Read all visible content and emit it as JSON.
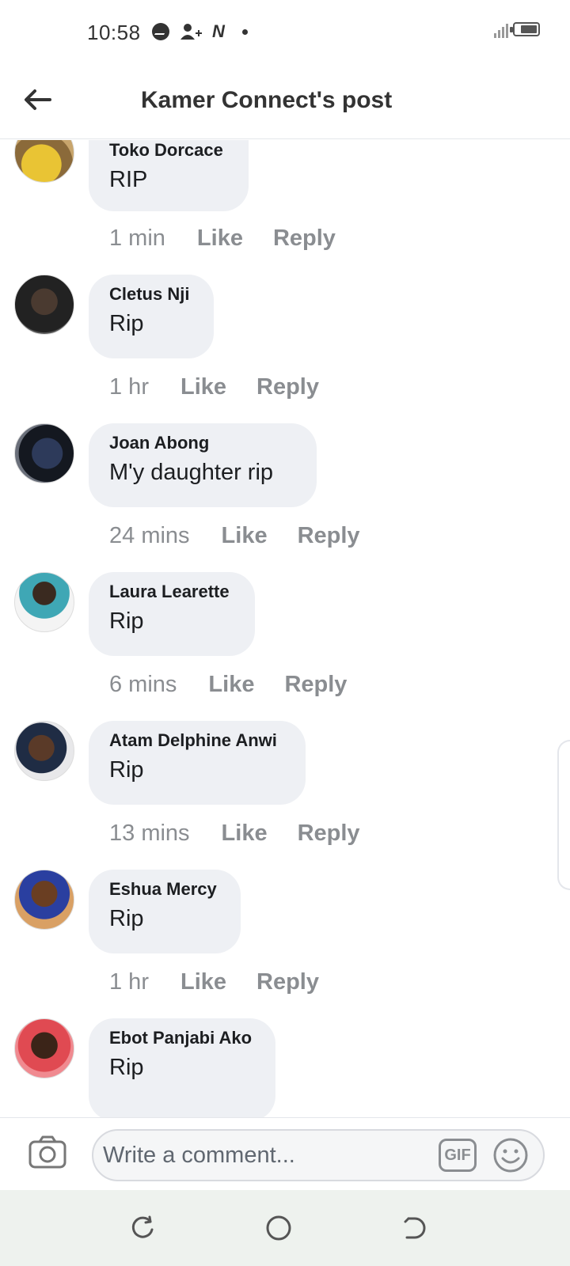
{
  "status_bar": {
    "time": "10:58",
    "notif_n": "N"
  },
  "header": {
    "title": "Kamer Connect's post"
  },
  "comments": [
    {
      "name": "Toko Dorcace",
      "text": "RIP",
      "time": "1 min",
      "like": "Like",
      "reply": "Reply"
    },
    {
      "name": "Cletus Nji",
      "text": "Rip",
      "time": "1 hr",
      "like": "Like",
      "reply": "Reply"
    },
    {
      "name": "Joan Abong",
      "text": "M'y daughter rip",
      "time": "24 mins",
      "like": "Like",
      "reply": "Reply"
    },
    {
      "name": "Laura Learette",
      "text": "Rip",
      "time": "6 mins",
      "like": "Like",
      "reply": "Reply"
    },
    {
      "name": "Atam Delphine Anwi",
      "text": "Rip",
      "time": "13 mins",
      "like": "Like",
      "reply": "Reply"
    },
    {
      "name": "Eshua Mercy",
      "text": "Rip",
      "time": "1 hr",
      "like": "Like",
      "reply": "Reply"
    },
    {
      "name": "Ebot Panjabi Ako",
      "text": "Rip"
    }
  ],
  "composer": {
    "placeholder": "Write a comment...",
    "gif_label": "GIF"
  },
  "icons": {
    "back": "back-arrow-icon",
    "camera": "camera-icon",
    "emoji": "emoji-icon",
    "nav_back": "nav-back-icon",
    "nav_home": "nav-home-icon",
    "nav_recents": "nav-recents-icon"
  },
  "colors": {
    "bubble": "#eef0f4",
    "secondary_text": "#8a8d91",
    "nav_bar": "#eef2ee"
  }
}
